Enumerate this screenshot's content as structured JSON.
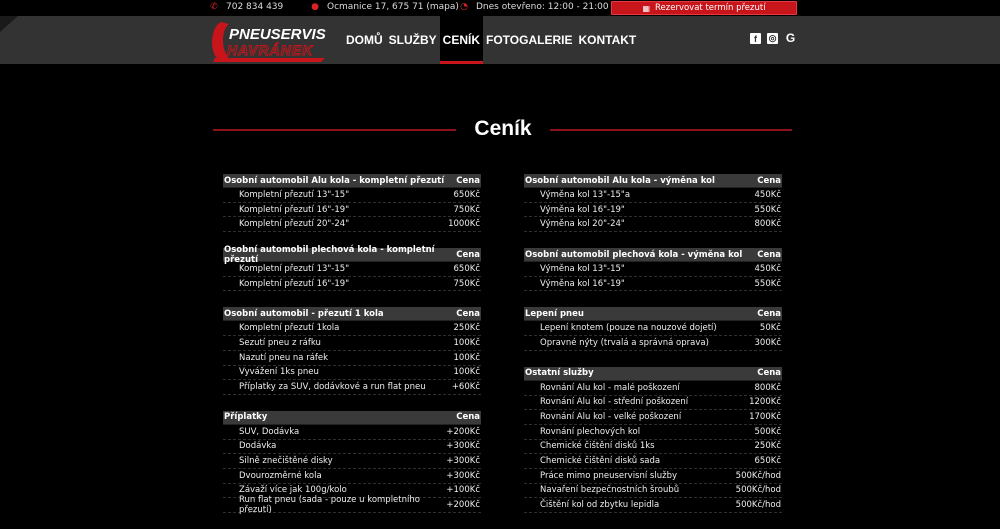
{
  "topbar": {
    "phone": "702 834 439",
    "address": "Ocmanice 17, 675 71 (mapa)",
    "hours": "Dnes otevřeno: 12:00 - 21:00",
    "reserve_label": "Rezervovat termín přezutí"
  },
  "logo": {
    "line1": "PNEUSERVIS",
    "line2": "HAVRÁNEK"
  },
  "nav": [
    {
      "label": "DOMŮ",
      "active": false
    },
    {
      "label": "SLUŽBY",
      "active": false
    },
    {
      "label": "CENÍK",
      "active": true
    },
    {
      "label": "FOTOGALERIE",
      "active": false
    },
    {
      "label": "KONTAKT",
      "active": false
    }
  ],
  "page_title": "Ceník",
  "colors": {
    "accent": "#c8141b",
    "header_bg": "#333333",
    "section_bg": "#3a3a3a"
  },
  "left_sections": [
    {
      "title": "Osobní automobil Alu kola - kompletní přezutí",
      "price_header": "Cena",
      "rows": [
        {
          "name": "Kompletní přezutí 13\"-15\"",
          "price": "650Kč"
        },
        {
          "name": "Kompletní přezutí 16\"-19\"",
          "price": "750Kč"
        },
        {
          "name": "Kompletní přezutí 20\"-24\"",
          "price": "1000Kč"
        }
      ]
    },
    {
      "title": "Osobní automobil plechová kola - kompletní přezutí",
      "price_header": "Cena",
      "rows": [
        {
          "name": "Kompletní přezutí 13\"-15\"",
          "price": "650Kč"
        },
        {
          "name": "Kompletní přezutí 16\"-19\"",
          "price": "750Kč"
        }
      ]
    },
    {
      "title": "Osobní automobil - přezutí 1 kola",
      "price_header": "Cena",
      "rows": [
        {
          "name": "Kompletní přezutí 1kola",
          "price": "250Kč"
        },
        {
          "name": "Sezutí pneu z ráfku",
          "price": "100Kč"
        },
        {
          "name": "Nazutí pneu na ráfek",
          "price": "100Kč"
        },
        {
          "name": "Vyvážení 1ks pneu",
          "price": "100Kč"
        },
        {
          "name": "Příplatky za SUV, dodávkové a run flat pneu",
          "price": "+60Kč"
        }
      ]
    },
    {
      "title": "Příplatky",
      "price_header": "Cena",
      "rows": [
        {
          "name": "SUV, Dodávka",
          "price": "+200Kč"
        },
        {
          "name": "Dodávka",
          "price": "+300Kč"
        },
        {
          "name": "Silně znečištěné disky",
          "price": "+300Kč"
        },
        {
          "name": "Dvourozměrné kola",
          "price": "+300Kč"
        },
        {
          "name": "Závaží více jak 100g/kolo",
          "price": "+100Kč"
        },
        {
          "name": "Run flat pneu (sada - pouze u kompletního přezutí)",
          "price": "+200Kč"
        }
      ]
    }
  ],
  "right_sections": [
    {
      "title": "Osobní automobil Alu kola - výměna kol",
      "price_header": "Cena",
      "rows": [
        {
          "name": "Výměna kol 13\"-15\"a",
          "price": "450Kč"
        },
        {
          "name": "Výměna kol 16\"-19\"",
          "price": "550Kč"
        },
        {
          "name": "Výměna kol 20\"-24\"",
          "price": "800Kč"
        }
      ]
    },
    {
      "title": "Osobní automobil plechová kola - výměna kol",
      "price_header": "Cena",
      "rows": [
        {
          "name": "Výměna kol 13\"-15\"",
          "price": "450Kč"
        },
        {
          "name": "Výměna kol 16\"-19\"",
          "price": "550Kč"
        }
      ]
    },
    {
      "title": "Lepení pneu",
      "price_header": "Cena",
      "rows": [
        {
          "name": "Lepení knotem (pouze na nouzové dojetí)",
          "price": "50Kč"
        },
        {
          "name": "Opravné nýty (trvalá a správná oprava)",
          "price": "300Kč"
        }
      ]
    },
    {
      "title": "Ostatní služby",
      "price_header": "Cena",
      "rows": [
        {
          "name": "Rovnání Alu kol - malé poškození",
          "price": "800Kč"
        },
        {
          "name": "Rovnání Alu kol - střední poškození",
          "price": "1200Kč"
        },
        {
          "name": "Rovnání Alu kol - velké poškození",
          "price": "1700Kč"
        },
        {
          "name": "Rovnání plechových kol",
          "price": "500Kč"
        },
        {
          "name": "Chemické čištění disků 1ks",
          "price": "250Kč"
        },
        {
          "name": "Chemické čištění disků sada",
          "price": "650Kč"
        },
        {
          "name": "Práce mimo pneuservisní služby",
          "price": "500Kč/hod"
        },
        {
          "name": "Navaření bezpečnostních šroubů",
          "price": "500Kč/hod"
        },
        {
          "name": "Čištění kol od zbytku lepidla",
          "price": "500Kč/hod"
        }
      ]
    }
  ]
}
